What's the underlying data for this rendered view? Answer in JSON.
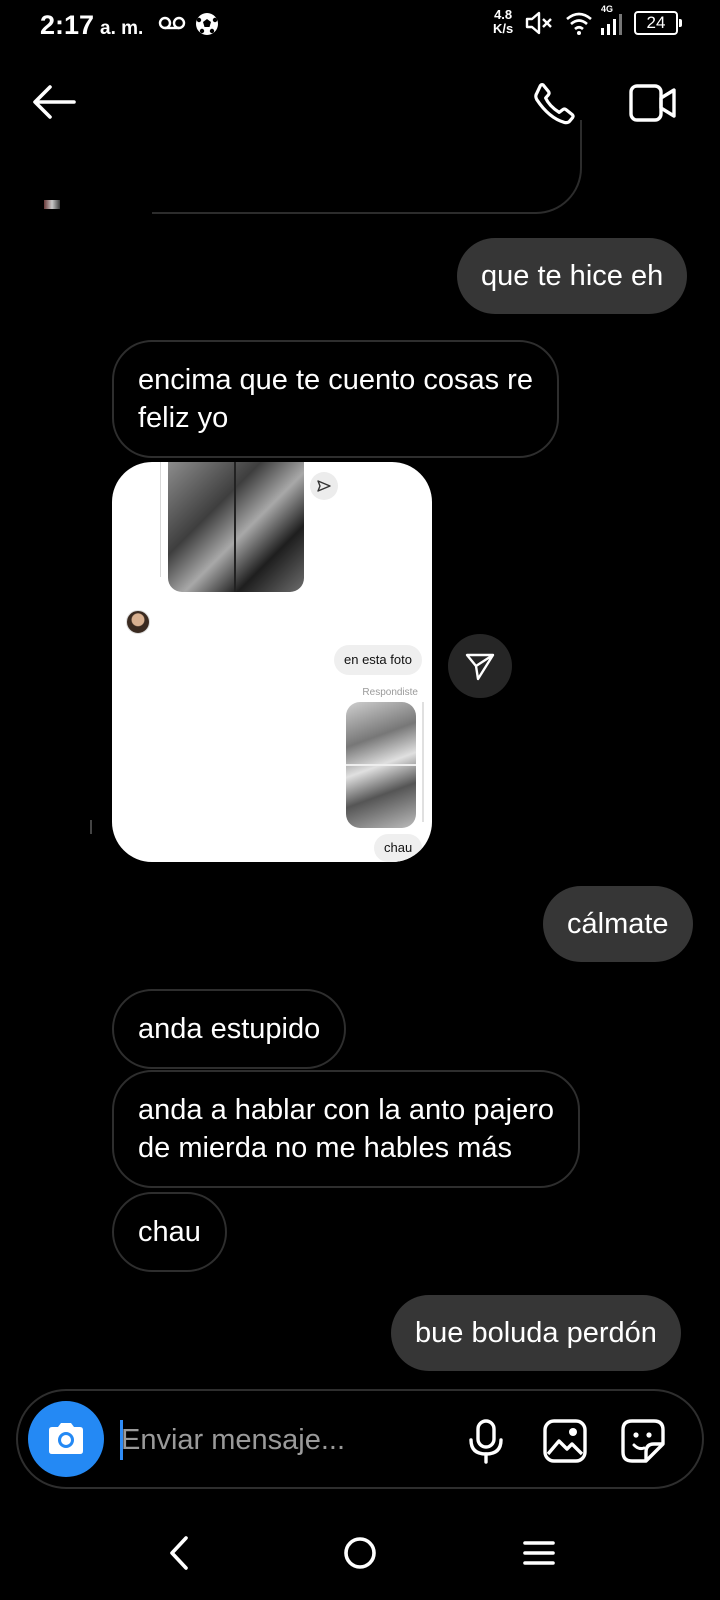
{
  "status_bar": {
    "time": "2:17",
    "ampm": "a. m.",
    "speed_value": "4.8",
    "speed_unit": "K/s",
    "network": "4G",
    "battery": "24"
  },
  "header": {
    "back_icon": "arrow-left-icon",
    "call_icon": "phone-icon",
    "video_icon": "video-camera-icon"
  },
  "messages": [
    {
      "side": "sent",
      "text": "que te hice eh"
    },
    {
      "side": "received",
      "lines": [
        "encima que te cuento cosas re",
        "feliz yo"
      ]
    },
    {
      "side": "sent",
      "text": "cálmate"
    },
    {
      "side": "received",
      "text": "anda estupido"
    },
    {
      "side": "received",
      "lines": [
        "anda a hablar con la anto pajero",
        "de mierda no me hables más"
      ]
    },
    {
      "side": "received",
      "text": "chau"
    },
    {
      "side": "sent",
      "text": "bue boluda perdón"
    }
  ],
  "shared_card": {
    "reaction_emoji": "😍",
    "pill_text": "en esta foto",
    "replied_label": "Respondiste",
    "bottom_pill": "chau"
  },
  "composer": {
    "placeholder": "Enviar mensaje...",
    "accent": "#2489f4"
  },
  "colors": {
    "background": "#000000",
    "sent_bubble": "#363636",
    "received_border": "#2e2e2e"
  }
}
